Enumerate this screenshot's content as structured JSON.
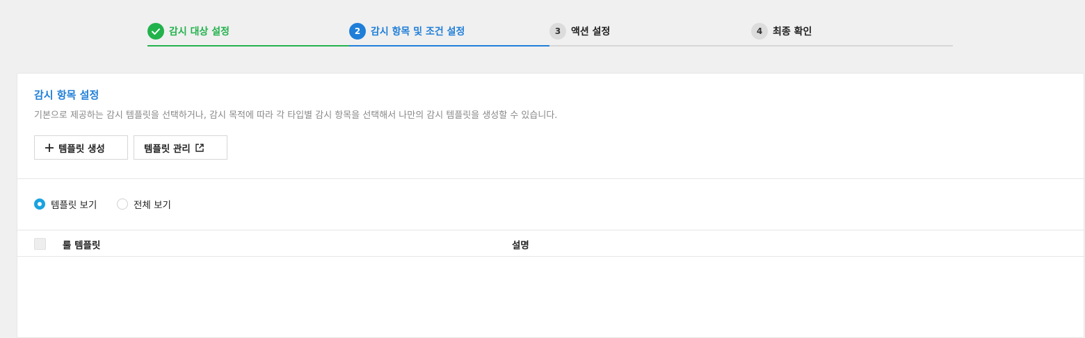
{
  "stepper": {
    "steps": [
      {
        "num": "",
        "label": "감시 대상 설정",
        "state": "done"
      },
      {
        "num": "2",
        "label": "감시 항목 및 조건 설정",
        "state": "active"
      },
      {
        "num": "3",
        "label": "액션 설정",
        "state": "pending"
      },
      {
        "num": "4",
        "label": "최종 확인",
        "state": "pending"
      }
    ]
  },
  "section": {
    "title": "감시 항목 설정",
    "description": "기본으로 제공하는 감시 템플릿을 선택하거나, 감시 목적에 따라 각 타입별 감시 항목을 선택해서 나만의 감시 템플릿을 생성할 수 있습니다."
  },
  "buttons": {
    "create_label": "템플릿 생성",
    "manage_label": "템플릿 관리"
  },
  "view_options": [
    {
      "label": "템플릿 보기",
      "checked": true
    },
    {
      "label": "전체 보기",
      "checked": false
    }
  ],
  "table": {
    "columns": [
      "룰 템플릿",
      "설명"
    ]
  },
  "colors": {
    "done": "#22b24c",
    "active": "#1f7ed8",
    "pending": "#dcdcdc",
    "radio_checked": "#1aa3e0"
  },
  "icons": {
    "step_done": "check-icon",
    "create": "plus-icon",
    "manage": "external-link-icon"
  }
}
